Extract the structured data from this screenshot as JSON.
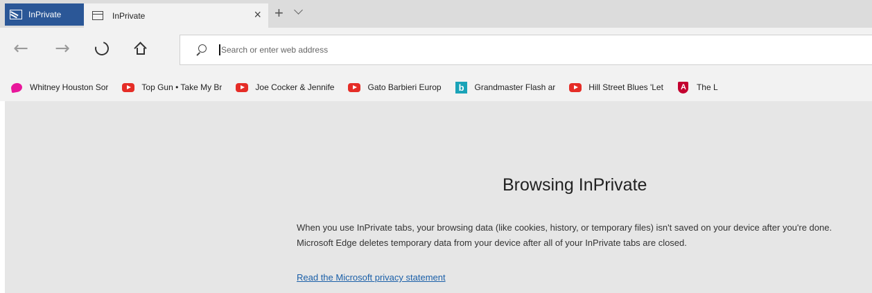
{
  "tabstrip": {
    "inprivate_badge": "InPrivate",
    "tab_title": "InPrivate",
    "close_glyph": "×",
    "new_tab_glyph": "+",
    "badge_icon": "inprivate-icon",
    "tab_icon": "tab-page-icon",
    "tab_list_icon": "chevron-down-icon"
  },
  "nav": {
    "back_glyph": "←",
    "forward_glyph": "→",
    "refresh_icon": "refresh-icon",
    "home_icon": "home-icon",
    "address_placeholder": "Search or enter web address",
    "search_icon": "search-icon"
  },
  "favorites": [
    {
      "icon": "heart-icon",
      "label": "Whitney Houston Sor"
    },
    {
      "icon": "youtube-icon",
      "label": "Top Gun • Take My Br"
    },
    {
      "icon": "youtube-icon",
      "label": "Joe Cocker & Jennife"
    },
    {
      "icon": "youtube-icon",
      "label": "Gato Barbieri  Europ"
    },
    {
      "icon": "bing-icon",
      "label": "Grandmaster Flash ar"
    },
    {
      "icon": "youtube-icon",
      "label": "Hill Street Blues  'Let"
    },
    {
      "icon": "shield-icon",
      "label": "The L"
    }
  ],
  "main": {
    "title": "Browsing InPrivate",
    "body": "When you use InPrivate tabs, your browsing data (like cookies, history, or temporary files) isn't saved on your device after you're done. Microsoft Edge deletes temporary data from your device after all of your InPrivate tabs are closed.",
    "link": "Read the Microsoft privacy statement"
  },
  "colors": {
    "inprivate_blue": "#2b5797",
    "content_bg": "#e6e6e6",
    "link": "#1a5fa8"
  }
}
